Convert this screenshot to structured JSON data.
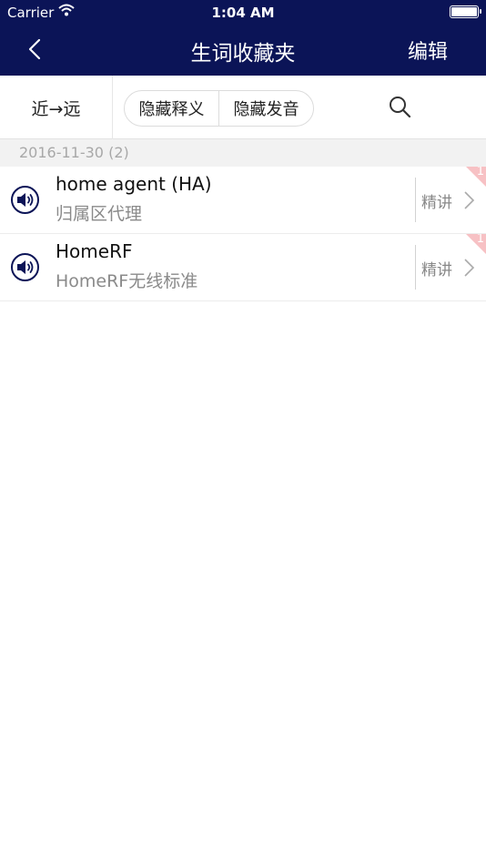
{
  "status_bar": {
    "carrier": "Carrier",
    "time": "1:04 AM"
  },
  "nav": {
    "title": "生词收藏夹",
    "edit_label": "编辑",
    "back_icon": "chevron-left-icon"
  },
  "toolbar": {
    "sort_label": "近→远",
    "hide_meaning_label": "隐藏释义",
    "hide_pronunciation_label": "隐藏发音",
    "search_icon": "search-icon"
  },
  "group": {
    "date_header": "2016-11-30 (2)"
  },
  "words": [
    {
      "word": "home agent (HA)",
      "meaning": "归属区代理",
      "detail_label": "精讲",
      "badge": "1"
    },
    {
      "word": "HomeRF",
      "meaning": "HomeRF无线标准",
      "detail_label": "精讲",
      "badge": "1"
    }
  ],
  "colors": {
    "nav_bg": "#0b1457",
    "icon": "#0b1457",
    "badge": "#f7c1c4"
  }
}
